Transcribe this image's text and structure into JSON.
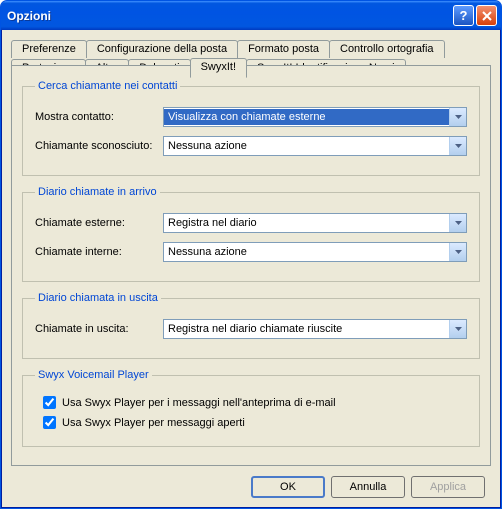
{
  "window_title": "Opzioni",
  "tabs_row1": [
    "Preferenze",
    "Configurazione della posta",
    "Formato posta",
    "Controllo ortografia"
  ],
  "tabs_row2": [
    "Protezione",
    "Altro",
    "Delegati",
    "SwyxIt!",
    "SwyxIt! Identificazione Nomi"
  ],
  "active_tab": "SwyxIt!",
  "group1": {
    "legend": "Cerca chiamante nei contatti",
    "row1_label": "Mostra contatto:",
    "row1_value": "Visualizza con chiamate esterne",
    "row2_label": "Chiamante sconosciuto:",
    "row2_value": "Nessuna azione"
  },
  "group2": {
    "legend": "Diario chiamate in arrivo",
    "row1_label": "Chiamate esterne:",
    "row1_value": "Registra nel diario",
    "row2_label": "Chiamate interne:",
    "row2_value": "Nessuna azione"
  },
  "group3": {
    "legend": "Diario chiamata in uscita",
    "row1_label": "Chiamate in uscita:",
    "row1_value": "Registra nel diario chiamate riuscite"
  },
  "group4": {
    "legend": "Swyx Voicemail Player",
    "chk1": "Usa Swyx Player per i messaggi nell'anteprima di e-mail",
    "chk2": "Usa Swyx Player per messaggi aperti"
  },
  "buttons": {
    "ok": "OK",
    "cancel": "Annulla",
    "apply": "Applica"
  }
}
